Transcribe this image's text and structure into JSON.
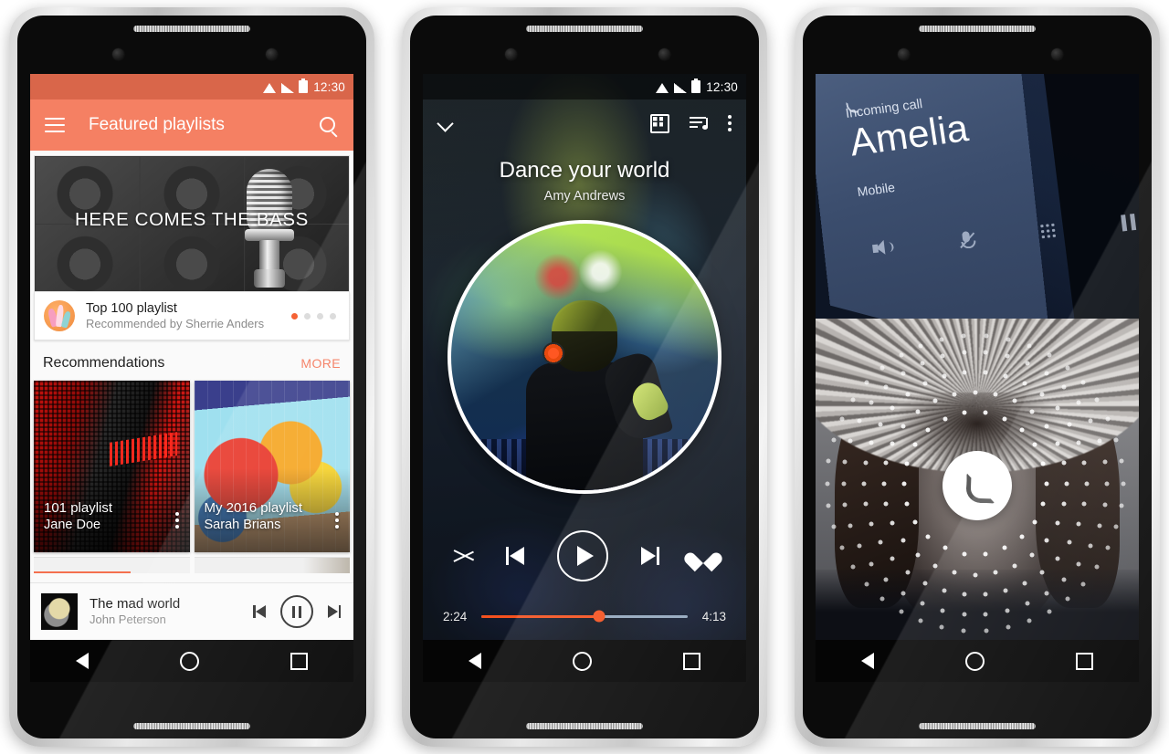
{
  "phones": [
    {
      "id": "music-library",
      "status_bar": {
        "time": "12:30",
        "icons": [
          "wifi-icon",
          "signal-icon",
          "battery-icon"
        ]
      },
      "appbar": {
        "menu_icon": "hamburger-icon",
        "title": "Featured playlists",
        "search_icon": "search-icon"
      },
      "hero": {
        "caption": "HERE COMES THE BASS",
        "art": "microphone-speakers"
      },
      "promo": {
        "title": "Top 100 playlist",
        "subtitle": "Recommended by Sherrie Anders",
        "pager_total": 4,
        "pager_active": 1
      },
      "section": {
        "title": "Recommendations",
        "more_label": "MORE"
      },
      "cards": [
        {
          "title": "101 playlist",
          "author": "Jane Doe",
          "art": "red-led-sign",
          "overflow_icon": "kebab-icon"
        },
        {
          "title": "My 2016 playlist",
          "author": "Sarah Brians",
          "art": "graffiti-wall",
          "overflow_icon": "kebab-icon"
        }
      ],
      "mini_player": {
        "track": "The mad world",
        "artist": "John Peterson",
        "prev_icon": "skip-previous-icon",
        "play_state_icon": "pause-icon",
        "next_icon": "skip-next-icon"
      },
      "nav": {
        "back": "back-icon",
        "home": "home-icon",
        "recents": "recents-icon"
      }
    },
    {
      "id": "now-playing",
      "status_bar": {
        "time": "12:30",
        "icons": [
          "wifi-icon",
          "signal-icon",
          "battery-icon"
        ]
      },
      "topbar": {
        "collapse_icon": "chevron-down-icon",
        "grid_icon": "grid-view-icon",
        "queue_icon": "playlist-queue-icon",
        "overflow_icon": "kebab-icon"
      },
      "track": {
        "title": "Dance your world",
        "artist": "Amy Andrews",
        "art": "dj-concert-circle"
      },
      "controls": {
        "shuffle_icon": "shuffle-icon",
        "prev_icon": "skip-previous-icon",
        "play_icon": "play-icon",
        "next_icon": "skip-next-icon",
        "favorite_icon": "heart-icon"
      },
      "progress": {
        "elapsed": "2:24",
        "total": "4:13",
        "percent": 57,
        "fill_color": "#f4511e",
        "track_color": "#93a7bd"
      },
      "nav": {
        "back": "back-icon",
        "home": "home-icon",
        "recents": "recents-icon"
      }
    },
    {
      "id": "incoming-call",
      "call": {
        "phone_icon": "phone-icon",
        "state_label": "Incoming call",
        "caller_name": "Amelia",
        "number_label": "Mobile"
      },
      "actions": [
        {
          "name": "speaker",
          "icon": "speaker-icon"
        },
        {
          "name": "mute",
          "icon": "mic-off-icon"
        },
        {
          "name": "dialpad",
          "icon": "dialpad-icon"
        },
        {
          "name": "hold",
          "icon": "pause-icon"
        }
      ],
      "answer": {
        "icon": "phone-icon",
        "label": ""
      },
      "photo": "caller-portrait-fur-hood",
      "nav": {
        "back": "back-icon",
        "home": "home-icon",
        "recents": "recents-icon"
      }
    }
  ],
  "theme": {
    "accent": "#f4511e",
    "appbar": "#f58063",
    "statusbar": "#d9664a",
    "more_link": "#f4795c",
    "call_panel": "#3b4d6d"
  }
}
